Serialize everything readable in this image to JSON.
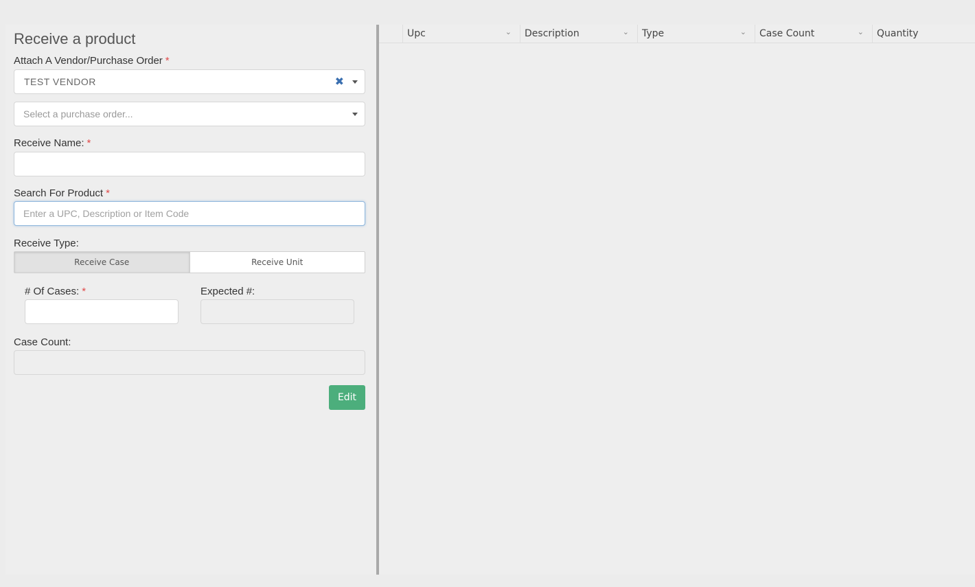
{
  "form": {
    "title": "Receive a product",
    "vendor_label": "Attach A Vendor/Purchase Order",
    "required_mark": "*",
    "vendor_value": "TEST VENDOR",
    "clear_glyph": "✖",
    "po_placeholder": "Select a purchase order...",
    "receive_name_label": "Receive Name:",
    "receive_name_value": "",
    "search_label": "Search For Product",
    "search_placeholder": "Enter a UPC, Description or Item Code",
    "receive_type_label": "Receive Type:",
    "receive_types": [
      "Receive Case",
      "Receive Unit"
    ],
    "selected_receive_type": "Receive Case",
    "cases_label": "# Of Cases:",
    "expected_label": "Expected #:",
    "case_count_label": "Case Count:",
    "edit_label": "Edit"
  },
  "grid": {
    "columns": [
      "Upc",
      "Description",
      "Type",
      "Case Count",
      "Quantity"
    ],
    "chevron_glyph": "⌄",
    "rows": []
  },
  "colors": {
    "required": "#e04a4a",
    "edit_button": "#4cae7c",
    "clear_icon": "#3a6fb0"
  },
  "icons": {
    "clear": "close-icon",
    "dropdown": "caret-down-icon",
    "column_menu": "chevron-down-icon"
  }
}
